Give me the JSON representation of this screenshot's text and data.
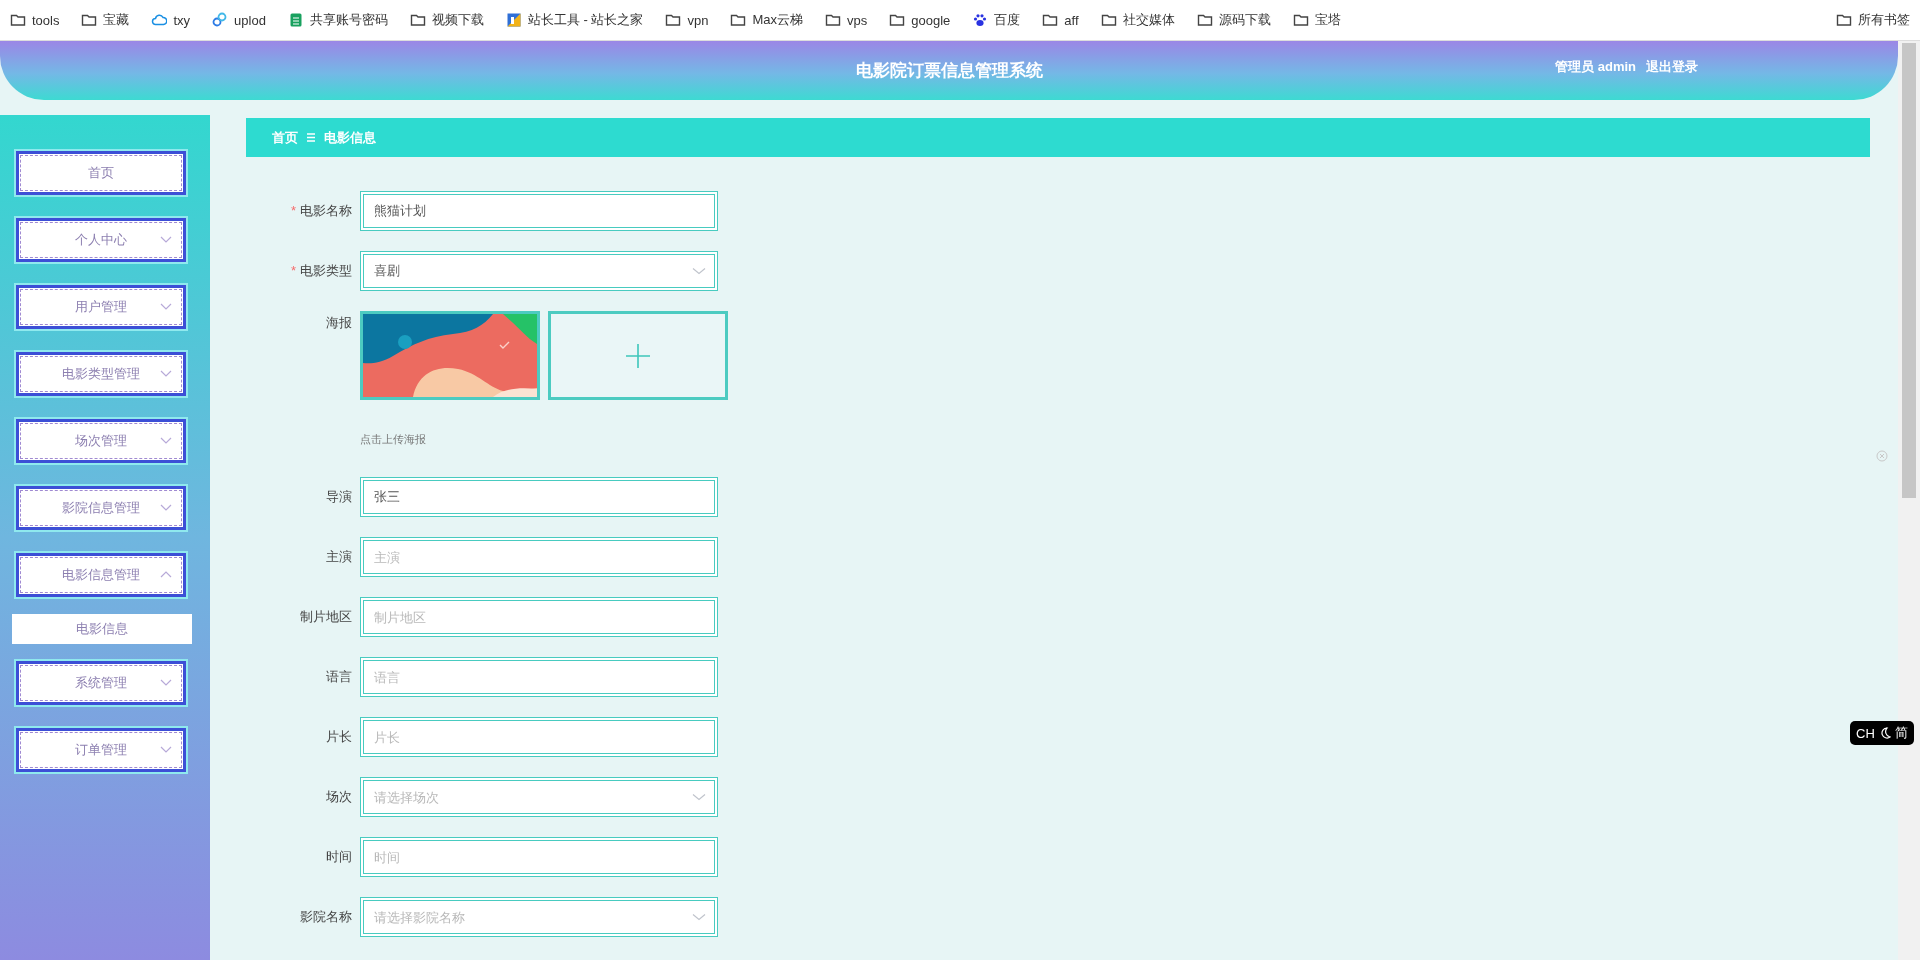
{
  "bookmarks": [
    {
      "label": "tools",
      "kind": "folder"
    },
    {
      "label": "宝藏",
      "kind": "folder"
    },
    {
      "label": "txy",
      "kind": "cloud"
    },
    {
      "label": "uplod",
      "kind": "app"
    },
    {
      "label": "共享账号密码",
      "kind": "sheet"
    },
    {
      "label": "视频下载",
      "kind": "folder"
    },
    {
      "label": "站长工具 - 站长之家",
      "kind": "tool"
    },
    {
      "label": "vpn",
      "kind": "folder"
    },
    {
      "label": "Max云梯",
      "kind": "folder"
    },
    {
      "label": "vps",
      "kind": "folder"
    },
    {
      "label": "google",
      "kind": "folder"
    },
    {
      "label": "百度",
      "kind": "paw"
    },
    {
      "label": "aff",
      "kind": "folder"
    },
    {
      "label": "社交媒体",
      "kind": "folder"
    },
    {
      "label": "源码下载",
      "kind": "folder"
    },
    {
      "label": "宝塔",
      "kind": "folder"
    }
  ],
  "all_bookmarks": {
    "label": "所有书签"
  },
  "header": {
    "title": "电影院订票信息管理系统",
    "user": "管理员 admin",
    "logout": "退出登录"
  },
  "sidebar": {
    "items": [
      {
        "label": "首页",
        "kind": "link"
      },
      {
        "label": "个人中心",
        "kind": "menu",
        "expanded": false
      },
      {
        "label": "用户管理",
        "kind": "menu",
        "expanded": false
      },
      {
        "label": "电影类型管理",
        "kind": "menu",
        "expanded": false
      },
      {
        "label": "场次管理",
        "kind": "menu",
        "expanded": false
      },
      {
        "label": "影院信息管理",
        "kind": "menu",
        "expanded": false
      },
      {
        "label": "电影信息管理",
        "kind": "menu",
        "expanded": true,
        "children": [
          {
            "label": "电影信息",
            "selected": true
          }
        ]
      },
      {
        "label": "系统管理",
        "kind": "menu",
        "expanded": false
      },
      {
        "label": "订单管理",
        "kind": "menu",
        "expanded": false
      }
    ]
  },
  "breadcrumb": [
    "首页",
    "电影信息"
  ],
  "form": {
    "required_mark": "*",
    "fields": [
      {
        "label": "电影名称",
        "kind": "text",
        "required": true,
        "value": "熊猫计划"
      },
      {
        "label": "电影类型",
        "kind": "select",
        "required": true,
        "value": "喜剧"
      },
      {
        "label": "海报",
        "kind": "upload",
        "required": false,
        "hint": "点击上传海报"
      },
      {
        "label": "导演",
        "kind": "text",
        "required": false,
        "value": "张三"
      },
      {
        "label": "主演",
        "kind": "text",
        "required": false,
        "placeholder": "主演"
      },
      {
        "label": "制片地区",
        "kind": "text",
        "required": false,
        "placeholder": "制片地区"
      },
      {
        "label": "语言",
        "kind": "text",
        "required": false,
        "placeholder": "语言"
      },
      {
        "label": "片长",
        "kind": "text",
        "required": false,
        "placeholder": "片长"
      },
      {
        "label": "场次",
        "kind": "select",
        "required": false,
        "placeholder": "请选择场次"
      },
      {
        "label": "时间",
        "kind": "text",
        "required": false,
        "placeholder": "时间"
      },
      {
        "label": "影院名称",
        "kind": "select",
        "required": false,
        "placeholder": "请选择影院名称"
      }
    ]
  },
  "ime": {
    "language": "CH",
    "script": "简"
  }
}
